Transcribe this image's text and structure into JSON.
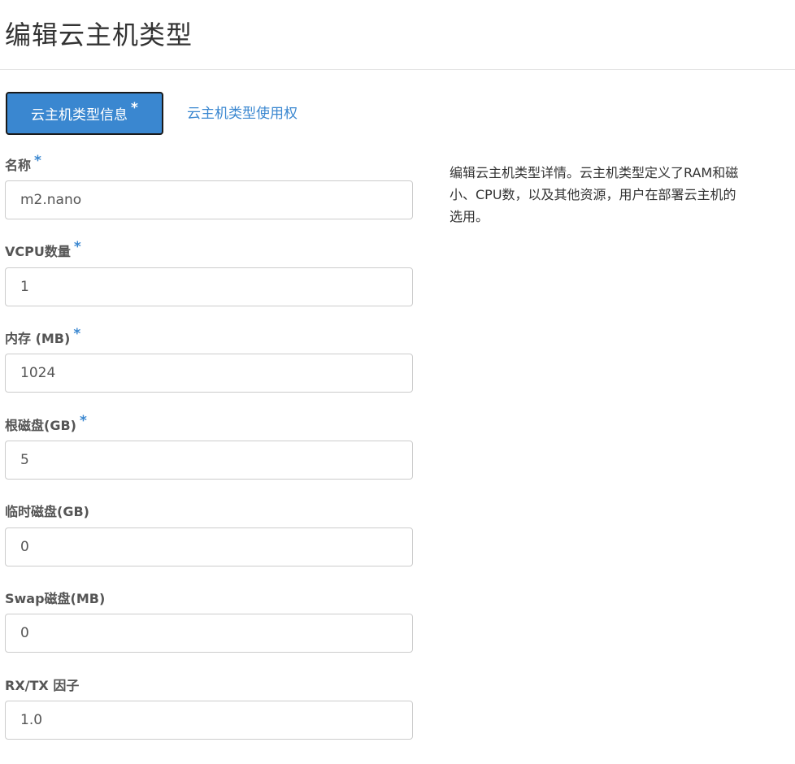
{
  "page": {
    "title": "编辑云主机类型"
  },
  "tabs": {
    "info_label": "云主机类型信息",
    "info_required_mark": "*",
    "access_label": "云主机类型使用权"
  },
  "form": {
    "name": {
      "label": "名称",
      "required": "*",
      "value": "m2.nano"
    },
    "vcpus": {
      "label": "VCPU数量",
      "required": "*",
      "value": "1"
    },
    "memory": {
      "label": "内存 (MB)",
      "required": "*",
      "value": "1024"
    },
    "root_disk": {
      "label": "根磁盘(GB)",
      "required": "*",
      "value": "5"
    },
    "ephemeral_disk": {
      "label": "临时磁盘(GB)",
      "value": "0"
    },
    "swap_disk": {
      "label": "Swap磁盘(MB)",
      "value": "0"
    },
    "rxtx_factor": {
      "label": "RX/TX 因子",
      "value": "1.0"
    }
  },
  "help": {
    "line1": "编辑云主机类型详情。云主机类型定义了RAM和磁",
    "line2": "小、CPU数，以及其他资源，用户在部署云主机的",
    "line3": "选用。"
  },
  "colors": {
    "accent": "#3a87d0",
    "label": "#555555",
    "border": "#cccccc"
  }
}
